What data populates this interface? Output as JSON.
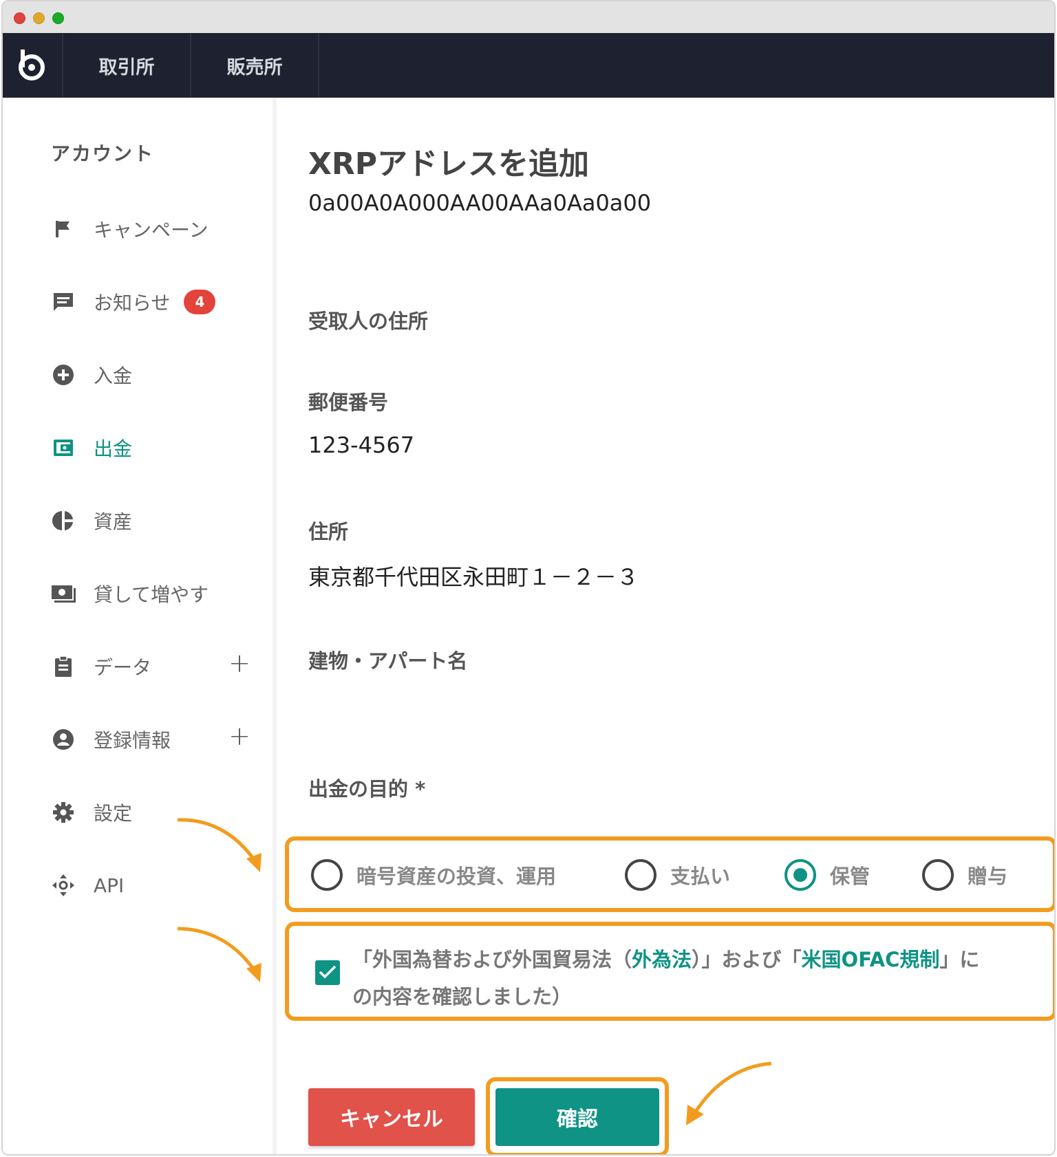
{
  "nav": {
    "tabs": [
      "取引所",
      "販売所"
    ]
  },
  "sidebar": {
    "heading": "アカウント",
    "items": [
      {
        "label": "キャンペーン",
        "icon": "flag-icon"
      },
      {
        "label": "お知らせ",
        "icon": "message-icon",
        "badge": "4"
      },
      {
        "label": "入金",
        "icon": "plus-circle-icon"
      },
      {
        "label": "出金",
        "icon": "wallet-icon",
        "active": true
      },
      {
        "label": "資産",
        "icon": "pie-chart-icon"
      },
      {
        "label": "貸して増やす",
        "icon": "money-icon"
      },
      {
        "label": "データ",
        "icon": "clipboard-icon",
        "expand": "+"
      },
      {
        "label": "登録情報",
        "icon": "user-circle-icon",
        "expand": "+"
      },
      {
        "label": "設定",
        "icon": "gear-icon"
      },
      {
        "label": "API",
        "icon": "api-icon"
      }
    ]
  },
  "main": {
    "title": "XRPアドレスを追加",
    "address": "0a00A0A000AA00AAa0Aa0a00",
    "recipient_label": "受取人の住所",
    "postal_label": "郵便番号",
    "postal_value": "123-4567",
    "address_label": "住所",
    "address_value": "東京都千代田区永田町１－２－３",
    "building_label": "建物・アパート名",
    "purpose_label": "出金の目的 *",
    "purpose_options": [
      "暗号資産の投資、運用",
      "支払い",
      "保管",
      "贈与"
    ],
    "purpose_selected": "保管",
    "consent": {
      "part1": "「外国為替および外国貿易法（",
      "link1": "外為法",
      "part2": "）」および「",
      "link2": "米国OFAC規制",
      "part3": "」に",
      "line2": "の内容を確認しました）",
      "checked": true
    },
    "cancel_label": "キャンセル",
    "confirm_label": "確認"
  },
  "colors": {
    "accent": "#0e9384",
    "highlight": "#f29c1f",
    "cancel": "#e0524a",
    "nav_bg": "#1e2230"
  }
}
